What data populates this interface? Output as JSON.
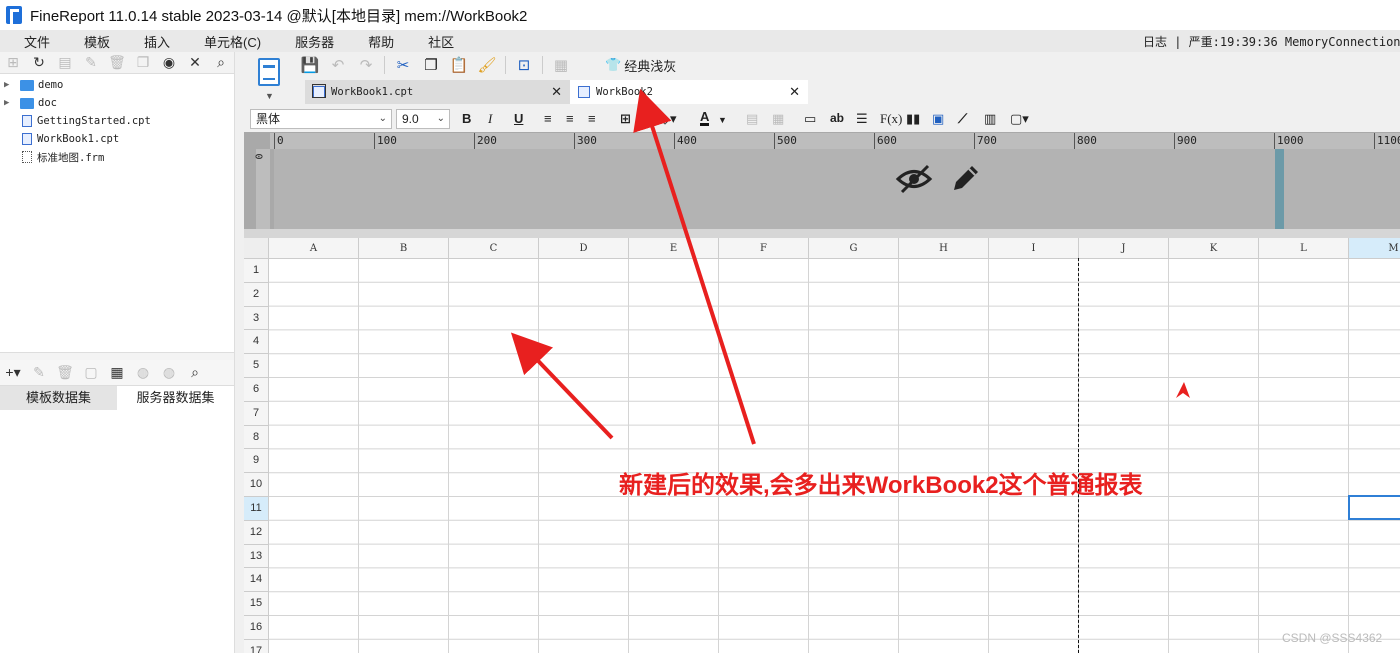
{
  "titlebar": {
    "title": "FineReport 11.0.14 stable 2023-03-14 @默认[本地目录]    mem://WorkBook2"
  },
  "menu": [
    "文件",
    "模板",
    "插入",
    "单元格(C)",
    "服务器",
    "帮助",
    "社区"
  ],
  "log_text": "日志 | 严重:19:39:36 MemoryConnection_Datas",
  "file_tree": [
    {
      "label": "demo",
      "type": "folder"
    },
    {
      "label": "doc",
      "type": "folder"
    },
    {
      "label": "GettingStarted.cpt",
      "type": "cpt"
    },
    {
      "label": "WorkBook1.cpt",
      "type": "cpt"
    },
    {
      "label": "标准地图.frm",
      "type": "frm"
    }
  ],
  "dataset_tabs": {
    "template": "模板数据集",
    "server": "服务器数据集"
  },
  "toolbar": {
    "theme_label": "经典浅灰"
  },
  "doc_tabs": [
    {
      "label": "WorkBook1.cpt",
      "active": false
    },
    {
      "label": "WorkBook2",
      "active": true
    }
  ],
  "format": {
    "font": "黑体",
    "size": "9.0"
  },
  "ruler": {
    "h_ticks": [
      "0",
      "100",
      "200",
      "300",
      "400",
      "500",
      "600",
      "700",
      "800",
      "900",
      "1000",
      "1100"
    ],
    "v_label": "0"
  },
  "columns": [
    "A",
    "B",
    "C",
    "D",
    "E",
    "F",
    "G",
    "H",
    "I",
    "J",
    "K",
    "L",
    "M"
  ],
  "rows": [
    "1",
    "2",
    "3",
    "4",
    "5",
    "6",
    "7",
    "8",
    "9",
    "10",
    "11",
    "12",
    "13",
    "14",
    "15",
    "16",
    "17"
  ],
  "selected": {
    "column": "M",
    "row": "11"
  },
  "annotation": "新建后的效果,会多出来WorkBook2这个普通报表",
  "watermark": "CSDN @SSS4362",
  "colors": {
    "accent": "#2f7fd6",
    "annotation": "#e8201f"
  }
}
